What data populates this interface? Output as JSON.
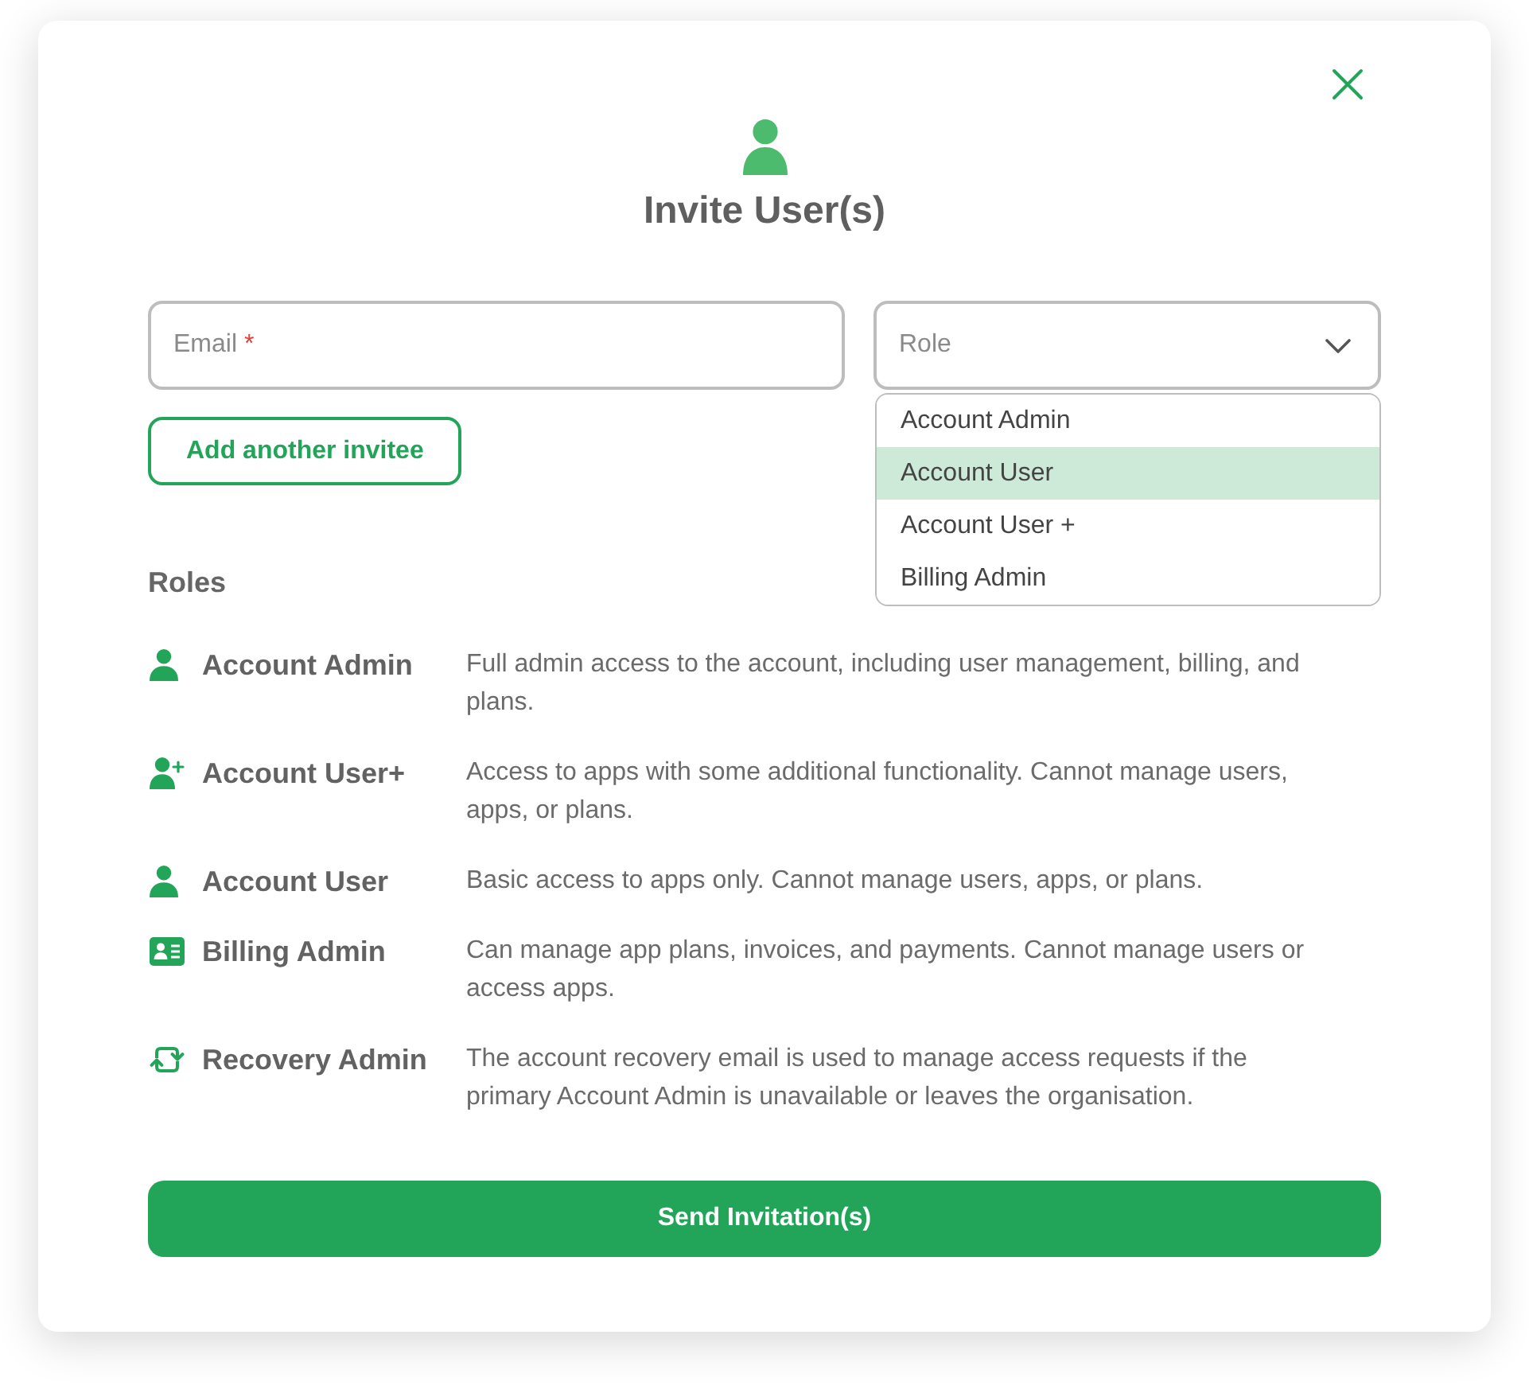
{
  "dialog": {
    "title": "Invite User(s)"
  },
  "email_field": {
    "placeholder": "Email",
    "required_mark": "*"
  },
  "role_select": {
    "placeholder": "Role",
    "expanded": true,
    "options": [
      {
        "label": "Account Admin",
        "selected": false
      },
      {
        "label": "Account User",
        "selected": true
      },
      {
        "label": "Account User +",
        "selected": false
      },
      {
        "label": "Billing Admin",
        "selected": false
      }
    ]
  },
  "add_invitee_button": {
    "label": "Add another invitee"
  },
  "roles": {
    "heading": "Roles",
    "items": [
      {
        "kind": "person",
        "name": "Account Admin",
        "description": "Full admin access to the account, including user management, billing, and plans."
      },
      {
        "kind": "person_plus",
        "name": "Account User+",
        "description": "Access to apps with some additional functionality. Cannot manage users, apps, or plans."
      },
      {
        "kind": "person",
        "name": "Account User",
        "description": "Basic access to apps only. Cannot manage users, apps, or plans."
      },
      {
        "kind": "card",
        "name": "Billing Admin",
        "description": "Can manage app plans, invoices, and payments. Cannot manage users or access apps."
      },
      {
        "kind": "cycle",
        "name": "Recovery Admin",
        "description": "The account recovery email is used to manage access requests if the primary Account Admin is unavailable or leaves the organisation."
      }
    ]
  },
  "send_button": {
    "label": "Send Invitation(s)"
  }
}
